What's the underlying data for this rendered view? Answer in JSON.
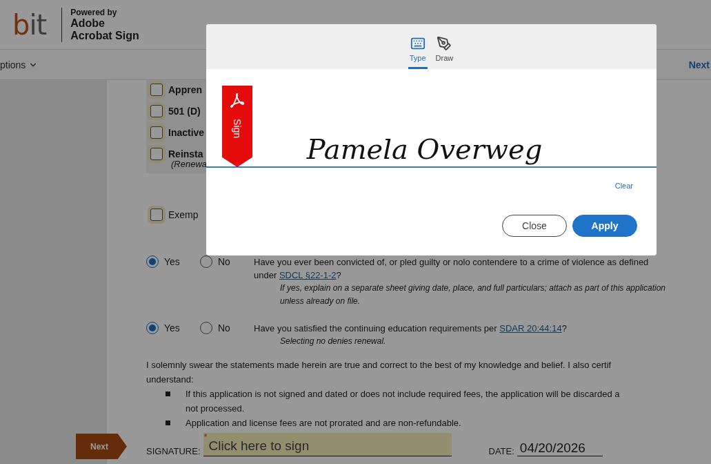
{
  "header": {
    "logo": "bit",
    "powered_by": "Powered by",
    "brand_lines": [
      "Adobe",
      "Acrobat Sign"
    ]
  },
  "toolbar": {
    "options": "ptions",
    "next": "Next"
  },
  "document": {
    "checkboxes": [
      {
        "label": "Appren",
        "checked": false
      },
      {
        "label": "501 (D)",
        "checked": false
      },
      {
        "label": "Inactive",
        "checked": false
      },
      {
        "label": "Reinsta",
        "note": "(Renewa",
        "checked": false
      }
    ],
    "exempt": {
      "label": "Exemp",
      "checked": false
    },
    "questions": [
      {
        "options": [
          {
            "label": "Yes",
            "selected": true
          },
          {
            "label": "No",
            "selected": false
          }
        ],
        "text": "Have you ever been convicted of, or pled guilty or nolo contendere to a crime of violence as defined under",
        "link": "SDCL §22-1-2",
        "after": "?",
        "note": "If yes, explain on a separate sheet giving date, place, and full particulars; attach as part of this application unless already on file."
      },
      {
        "options": [
          {
            "label": "Yes",
            "selected": true
          },
          {
            "label": "No",
            "selected": false
          }
        ],
        "text": "Have you satisfied the continuing education requirements per",
        "link": "SDAR 20:44:14",
        "after": "?",
        "note": "Selecting no denies renewal."
      }
    ],
    "oath_lines": [
      "I solemnly swear the statements made herein are true and correct to the best of my knowledge and belief. I also certif",
      "understand:"
    ],
    "bullets": [
      {
        "lines": [
          "If this application is not signed and dated or does not include required fees, the application will be discarded a",
          "not processed."
        ]
      },
      {
        "lines": [
          "Application and license fees are not prorated and are non-refundable."
        ]
      }
    ],
    "signature_label": "SIGNATURE:",
    "signature_field": {
      "placeholder": "Click here to sign",
      "required_mark": "*"
    },
    "date_label": "DATE:",
    "date_value": "04/20/2026"
  },
  "next_tab": "Next",
  "modal": {
    "tabs": [
      {
        "label": "Type",
        "kind": "keyboard",
        "selected": true
      },
      {
        "label": "Draw",
        "kind": "pen",
        "selected": false
      }
    ],
    "sign_tag": "Sign",
    "signature": "Pamela Overweg",
    "clear": "Clear",
    "buttons": [
      {
        "label": "Close",
        "kind": "secondary"
      },
      {
        "label": "Apply",
        "kind": "primary"
      }
    ]
  }
}
